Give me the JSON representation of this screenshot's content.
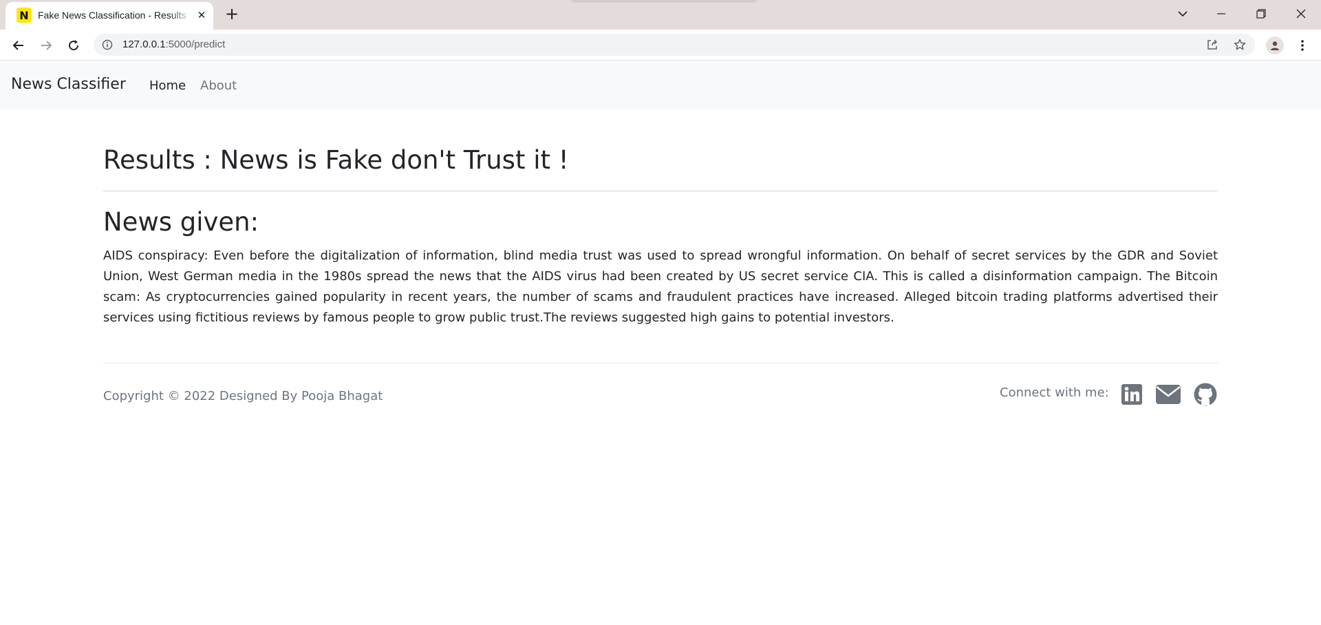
{
  "browser": {
    "tab_title": "Fake News Classification - Results",
    "favicon_letter": "N",
    "url_host": "127.0.0.1",
    "url_path": ":5000/predict"
  },
  "navbar": {
    "brand": "News Classifier",
    "links": [
      {
        "label": "Home",
        "active": true
      },
      {
        "label": "About",
        "active": false
      }
    ]
  },
  "main": {
    "result_title": "Results : News is Fake don't Trust it !",
    "news_heading": "News given:",
    "news_text": "AIDS conspiracy: Even before the digitalization of information, blind media trust was used to spread wrongful information. On behalf of secret services by the GDR and Soviet Union, West German media in the 1980s spread the news that the AIDS virus had been created by US secret service CIA. This is called a disinformation campaign. The Bitcoin scam: As cryptocurrencies gained popularity in recent years, the number of scams and fraudulent practices have increased. Alleged bitcoin trading platforms advertised their services using fictitious reviews by famous people to grow public trust.The reviews suggested high gains to potential investors."
  },
  "footer": {
    "copyright": "Copyright © 2022 Designed By Pooja Bhagat",
    "connect_label": "Connect with me:",
    "social_icons": [
      "linkedin-icon",
      "email-icon",
      "github-icon"
    ]
  },
  "colors": {
    "tabstrip": "#e4dcdb",
    "navbar_bg": "#f8f9fa",
    "text_dark": "#212529",
    "text_muted": "#6c757d",
    "favicon_bg": "#ffe800"
  }
}
